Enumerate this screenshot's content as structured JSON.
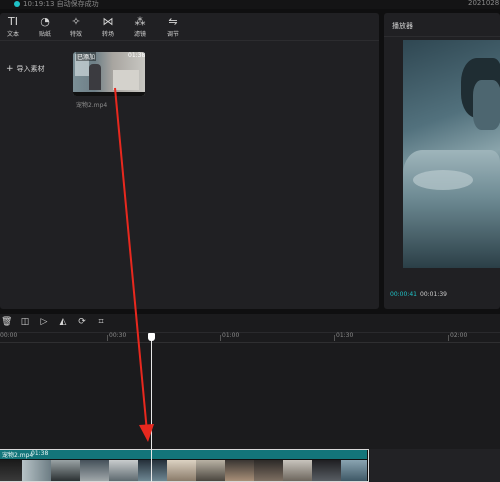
{
  "status": {
    "text": "10:19:13 自动保存成功",
    "date": "2021028"
  },
  "toolbar": {
    "items": [
      {
        "icon": "text-icon",
        "glyph": "TI",
        "label": "文本"
      },
      {
        "icon": "sticker-icon",
        "glyph": "◔",
        "label": "贴纸"
      },
      {
        "icon": "effects-icon",
        "glyph": "✧",
        "label": "特效"
      },
      {
        "icon": "transition-icon",
        "glyph": "⋈",
        "label": "转场"
      },
      {
        "icon": "filter-icon",
        "glyph": "⁂",
        "label": "滤镜"
      },
      {
        "icon": "adjust-icon",
        "glyph": "⇋",
        "label": "调节"
      }
    ]
  },
  "media": {
    "import_label": "导入素材",
    "clip": {
      "badge": "已添加",
      "duration": "01:38",
      "name": "宠物2.mp4"
    }
  },
  "player": {
    "title": "播放器",
    "time_current": "00:00:41",
    "time_total": "00:01:39"
  },
  "timeline": {
    "tools": [
      "delete-icon",
      "split-icon",
      "freeze-icon",
      "mirror-icon",
      "rotate-icon",
      "crop-icon"
    ],
    "ticks": [
      "00:00",
      "00:30",
      "01:00",
      "01:30",
      "02:00"
    ],
    "clip": {
      "name": "宠物2.mp4",
      "duration": "01:38"
    }
  },
  "colors": {
    "accent": "#1fc2c7",
    "clip_header": "#13757a",
    "arrow": "#e8281e"
  }
}
